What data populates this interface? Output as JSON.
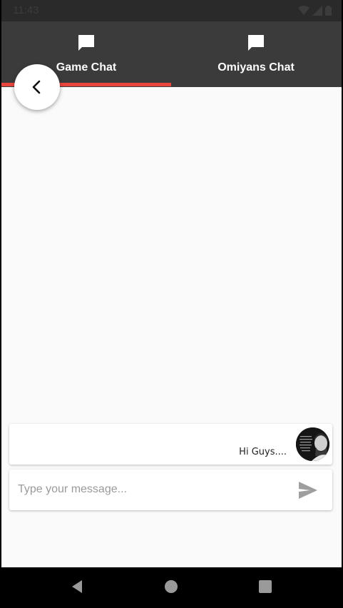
{
  "status_bar": {
    "time": "11:43",
    "icons": [
      "wifi-icon",
      "signal-icon",
      "battery-icon"
    ]
  },
  "tabs": [
    {
      "label": "Game Chat",
      "icon": "chat-bubble-icon",
      "selected": true
    },
    {
      "label": "Omiyans Chat",
      "icon": "chat-bubble-icon",
      "selected": false
    }
  ],
  "back_button": {
    "icon": "chevron-left-icon"
  },
  "messages": [
    {
      "text": "Hi Guys....",
      "avatar": "user-avatar"
    }
  ],
  "composer": {
    "placeholder": "Type your message...",
    "value": "",
    "send_icon": "send-icon"
  },
  "nav_bar": {
    "buttons": [
      "back-triangle-icon",
      "home-circle-icon",
      "recents-square-icon"
    ]
  },
  "colors": {
    "tab_bar": "#3b3b3b",
    "indicator": "#e8453c",
    "background": "#fafafa"
  }
}
